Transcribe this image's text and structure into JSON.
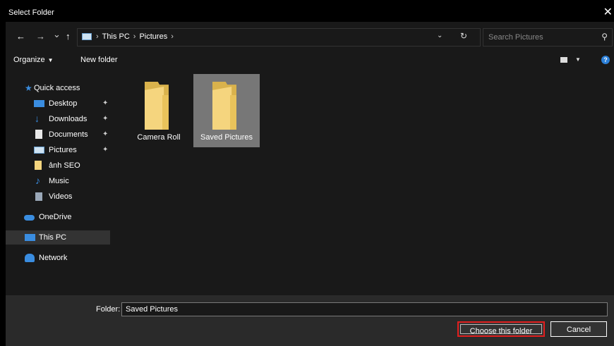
{
  "window": {
    "title": "Select Folder",
    "close_glyph": "✕"
  },
  "nav": {
    "back_glyph": "←",
    "forward_glyph": "→",
    "recent_glyph": "⌄",
    "up_glyph": "↑",
    "breadcrumbs": [
      "This PC",
      "Pictures"
    ],
    "breadcrumb_sep": "›",
    "search_placeholder": "Search Pictures"
  },
  "toolbar": {
    "organize": "Organize",
    "new_folder": "New folder",
    "help": "?"
  },
  "sidebar": {
    "items": [
      {
        "label": "Quick access",
        "icon": "star-icon",
        "pinned": false
      },
      {
        "label": "Desktop",
        "icon": "desktop-icon",
        "pinned": true
      },
      {
        "label": "Downloads",
        "icon": "download-arrow-icon",
        "pinned": true
      },
      {
        "label": "Documents",
        "icon": "document-icon",
        "pinned": true
      },
      {
        "label": "Pictures",
        "icon": "pictures-icon",
        "pinned": true
      },
      {
        "label": "ảnh SEO",
        "icon": "folder-icon",
        "pinned": false
      },
      {
        "label": "Music",
        "icon": "music-note-icon",
        "pinned": false
      },
      {
        "label": "Videos",
        "icon": "video-icon",
        "pinned": false
      },
      {
        "label": "OneDrive",
        "icon": "cloud-icon",
        "pinned": false
      },
      {
        "label": "This PC",
        "icon": "computer-icon",
        "pinned": false,
        "selected": true
      },
      {
        "label": "Network",
        "icon": "network-icon",
        "pinned": false
      }
    ],
    "pin_glyph": "📌"
  },
  "content": {
    "folders": [
      {
        "name": "Camera Roll",
        "selected": false
      },
      {
        "name": "Saved Pictures",
        "selected": true
      }
    ]
  },
  "footer": {
    "folder_label": "Folder:",
    "folder_value": "Saved Pictures",
    "choose_button": "Choose this folder",
    "cancel_button": "Cancel"
  },
  "colors": {
    "accent": "#2b7fd8",
    "highlight": "#e01e1e",
    "background": "#191919",
    "folder": "#f5d57e"
  }
}
